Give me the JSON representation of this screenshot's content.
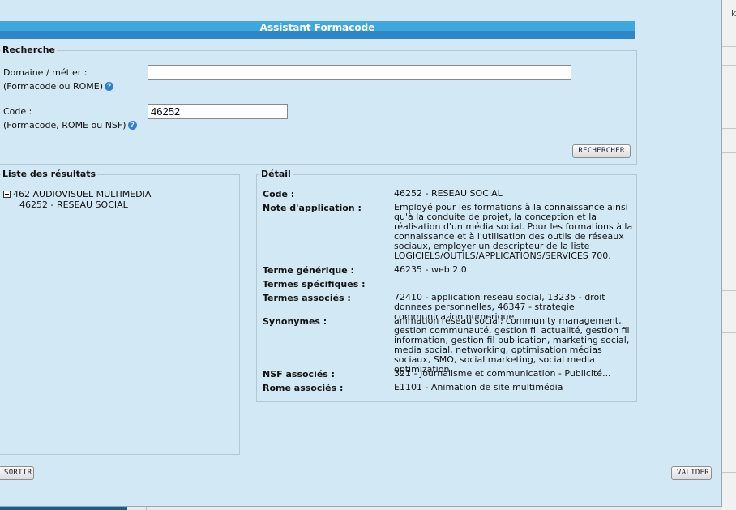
{
  "dialog": {
    "title": "Assistant Formacode"
  },
  "search": {
    "legend": "Recherche",
    "domaine_label": "Domaine / métier :",
    "domaine_sub": "(Formacode ou ROME)",
    "domaine_value": "",
    "code_label": "Code :",
    "code_sub": "(Formacode, ROME ou NSF)",
    "code_value": "46252",
    "help_glyph": "?",
    "search_button": "RECHERCHER"
  },
  "results": {
    "legend": "Liste des résultats",
    "tree": [
      {
        "label": "462 AUDIOVISUEL MULTIMEDIA",
        "children": [
          {
            "label": "46252 - RESEAU SOCIAL"
          }
        ]
      }
    ]
  },
  "detail": {
    "legend": "Détail",
    "rows": [
      {
        "label": "Code :",
        "value": "46252 - RESEAU SOCIAL"
      },
      {
        "label": "Note d'application :",
        "value": "Employé pour les formations à la connaissance ainsi qu'à la conduite de projet, la conception et la réalisation d'un média social. Pour les formations à la connaissance et à l'utilisation des outils de réseaux sociaux, employer un descripteur de la liste LOGICIELS/OUTILS/APPLICATIONS/SERVICES 700."
      },
      {
        "label": "Terme générique :",
        "value": "46235 - web 2.0"
      },
      {
        "label": "Termes spécifiques :",
        "value": ""
      },
      {
        "label": "Termes associés :",
        "value": "72410 - application reseau social, 13235 - droit donnees personnelles, 46347 - strategie communication numerique"
      },
      {
        "label": "Synonymes :",
        "value": "animation réseau social, community management, gestion communauté, gestion fil actualité, gestion fil information, gestion fil publication, marketing social, media social, networking, optimisation médias sociaux, SMO, social marketing, social media optimization"
      },
      {
        "label": "NSF associés :",
        "value": "321 - Journalisme et communication - Publicité..."
      },
      {
        "label": "Rome associés :",
        "value": "E1101 - Animation de site multimédia"
      }
    ]
  },
  "footer": {
    "exit_button": "SORTIR",
    "validate_button": "VALIDER"
  },
  "background": {
    "right_letter": "k"
  },
  "colors": {
    "dialog_bg": "#d2e9f5",
    "title_bar": "#3fa7de",
    "title_bar_dark": "#2f86c6"
  }
}
